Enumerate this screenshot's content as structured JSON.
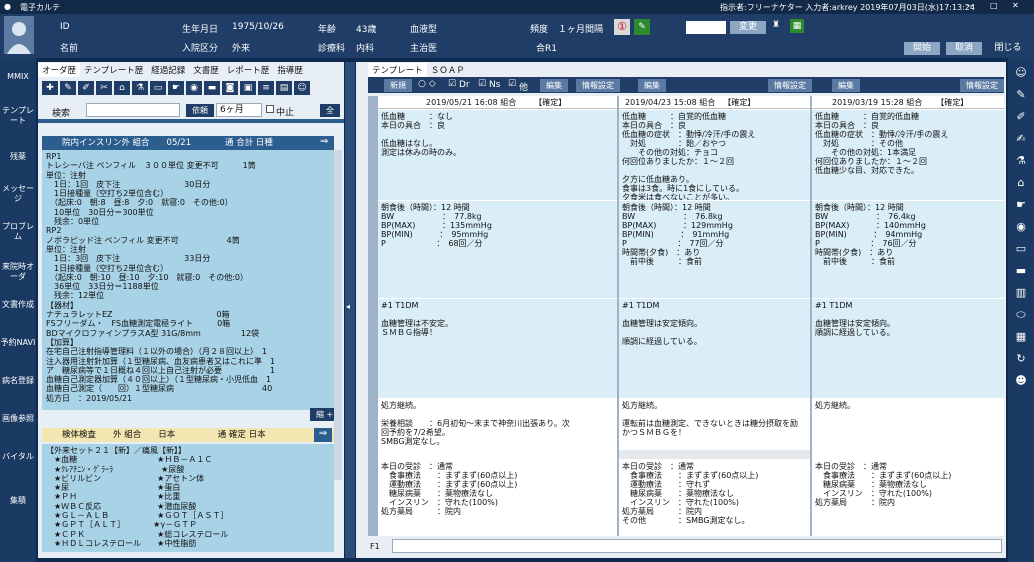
{
  "app": {
    "title": "電子カルテ"
  },
  "titlebar": {
    "info": "指示者:フリーナケター 入力者:arkrey 2019年07月03日(水)17:13:24",
    "min": "—",
    "max": "□",
    "close": "✕"
  },
  "patient": {
    "id_label": "ID",
    "name_label": "名前",
    "dob_label": "生年月日",
    "dob": "1975/10/26",
    "admit_label": "入院区分",
    "admit": "外来",
    "age_label": "年齢",
    "age": "43歳",
    "dept_label": "診療科",
    "dept": "内科",
    "blood_label": "血液型",
    "disease_label": "主治医",
    "freq_label": "頻度",
    "freq": "１ヶ月間隔",
    "room": "合R1",
    "alert": "①",
    "change_btn": "変更",
    "open_btn": "開始",
    "cancel_btn": "取消",
    "close_btn": "閉じる"
  },
  "leftnav": [
    "MMIX",
    "テンプレート",
    "残薬",
    "メッセージ",
    "プロブレム",
    "来院時オーダ",
    "文書作成",
    "予約NAVI",
    "病名登録",
    "画像参照",
    "バイタル",
    "集積"
  ],
  "leftpanel": {
    "tabs": [
      "オーダ歴",
      "テンプレート歴",
      "経過記録",
      "文書歴",
      "レポート歴",
      "指導歴"
    ],
    "search_label": "検索",
    "search_btn": "依頼",
    "period": "6ヶ月",
    "pause_label": "中止",
    "all_btn": "全",
    "order1_head": "院内インスリン外 組合　　05/21　　　　通 合計 日種",
    "order1_body": "RP1\nトレシーバ注 ペンフィル　３００単位 変更不可　　　1筒\n単位：注射\n　1日：1回　皮下注　　　　　　　　30日分\n　1日接種量（空打ち2単位含む）\n　（起床:0　朝:8　昼:8　夕:0　就寝:0　その他:0）\n　10単位　30日分＝300単位\n　残余：0単位\nRP2\nノボラピッド注 ペンフィル 変更不可　　　　　　4筒\n単位：注射\n　1日：3回　皮下注　　　　　　　　33日分\n　1日接種量（空打ち2単位含む）\n　（起床:0　朝:10　昼:10　夕:10　就寝:0　その他:0）\n　36単位　33日分＝1188単位\n　残余：12単位\n【器材】\nナチュラレットEZ　　　　　　　　　　　　　0箱\nFSフリーダム・　FS血糖測定電極ライト　　　0箱\nBDマイクロファインプラスA型 31G/8mm　　　　　12袋\n【加算】\n在宅自己注射指導管理料（１以外の場合）（月２８回以上）　1\n注入器用注射針加算（１型糖尿病、血友病患者又はこれに準　1\nア　糖尿病等で１日概ね４回以上自己注射が必要　　　　　　1\n血糖自己測定器加算（４０回以上）（１型糖尿病・小児低血　1\n血糖自己測定（　　回）１型糖尿病　　　　　　　　　　　40\n処方日　：2019/05/21",
    "more_btn": "縮 +",
    "order2_head": "検体検査　　外 組合　　日本　　　　　通 確定 日本",
    "order2_body": "【外来セット２１【新】／痛風【新】】\n　★血糖　　　　　　　　　　★ＨＢ－Ａ１Ｃ\n　★ｸﾚｱﾁﾆﾝ・ｸﾞﾗｰﾗ　　　　　　★尿酸\n　★ビリルビン　　　　　　　★アセトン体\n　★尿　　　　　　　　　　　★蛋白\n　★ＰＨ　　　　　　　　　　★比重\n　★ＷＢＣ反応　　　　　　　★潜血尿酸\n　★ＧＬ－ＡＬＢ　　　　　　★ＧＯＴ［ＡＳＴ］\n　★ＧＰＴ［ＡＬＴ］　　　　★γ－ＧＴＰ\n　★ＣＰＫ　　　　　　　　　★総コレステロール\n　★ＨＤＬコレステロール　　★中性脂肪"
  },
  "rightpanel": {
    "tabs": [
      "テンプレート",
      "ＳＯＡＰ"
    ],
    "new_btn": "新規",
    "chk_dr": "Dr",
    "chk_ns": "Ns",
    "chk_other": "他",
    "edit_btn": "編集",
    "info_btn": "情報設定",
    "columns": [
      {
        "date": "2019/05/21 16:08 組合",
        "status": "【確定】",
        "s": "低血糖　　　：なし\n本日の具合　：良\n\n低血糖はなし。\n測定は休みの時のみ。",
        "o": "朝食後（時間）：12 時間\nBW　　　　　　：　77.8kg\nBP(MAX)　　　 ：135mmHg\nBP(MIN)　　　 ：　95mmHg\nP　　　　　　 ：　68回／分",
        "a": "#1 T1DM\n\n血糖管理は不安定。\nＳＭＢＧ指導！",
        "p": "処方継続。\n\n栄養相談　　：6月初旬～末まで神奈川出張あり。次\n回予約を7/2希望。\nSMBG測定なし。",
        "x": "本日の受診　：通常\n　食事療法　　：まずまず(60点以上)\n　運動療法　　：まずまず(60点以上)\n　糖尿病薬　　：薬物療法なし\n　インスリン　：守れた(100%)\n処方薬局　　　：院内"
      },
      {
        "date": "2019/04/23 15:08 組合",
        "status": "【確定】",
        "s": "低血糖　　　：自覚的低血糖\n本日の具合　：良\n低血糖の症状　：動悸/冷汗/手の震え\n　対処　　　　：飴／おやつ\n　　その他の対処：チョコ\n何回位ありましたか：１～２回\n\n夕方に低血糖あり。\n食事は3食。時に1食にしている。\n夕食米は食べないことが多い。",
        "o": "朝食後（時間）：12 時間\nBW　　　　　　：　76.8kg\nBP(MAX)　　　 ：129mmHg\nBP(MIN)　　　 ：　91mmHg\nP　　　　　　 ：　77回／分\n時間帯(夕食)　：あり\n　前中後　　　：食前",
        "a": "#1 T1DM\n\n血糖管理は安定傾向。\n\n順調に経過している。",
        "p": "処方継続。\n\n運転前は血糖測定、できないときは糖分摂取を励\nかつＳＭＢＧを！",
        "x": "本日の受診　：通常\n　食事療法　　：まずまず(60点以上)\n　運動療法　　：守れず\n　糖尿病薬　　：薬物療法なし\n　インスリン　：守れた(100%)\n処方薬局　　　：院内\nその他　　　　：SMBG測定なし。"
      },
      {
        "date": "2019/03/19 15:28 組合",
        "status": "【確定】",
        "s": "低血糖　　　：自覚的低血糖\n本日の具合　：良\n低血糖の症状　：動悸/冷汗/手の震え\n　対処　　　　：その他\n　　その他の対処：1本満足\n何回位ありましたか：１～２回\n低血糖少な目、対応できた。",
        "o": "朝食後（時間）：12 時間\nBW　　　　　　：　76.4kg\nBP(MAX)　　　 ：140mmHg\nBP(MIN)　　　 ：　94mmHg\nP　　　　　　 ：　76回／分\n時間帯(夕食)　：あり\n　前中後　　　：食前",
        "a": "#1 T1DM\n\n血糖管理は安定傾向。\n順調に経過している。",
        "p": "処方継続。",
        "x": "本日の受診　：通常\n　食事療法　　：まずまず(60点以上)\n　糖尿病薬　　：薬物療法なし\n　インスリン　：守れた(100%)\n処方薬局　　　：院内"
      }
    ],
    "f1": "F1"
  },
  "colors": {
    "nav": "#1b3a63",
    "header": "#1f3d66",
    "order": "#a8d2e6",
    "accent_yellow": "#f3e6b0"
  }
}
